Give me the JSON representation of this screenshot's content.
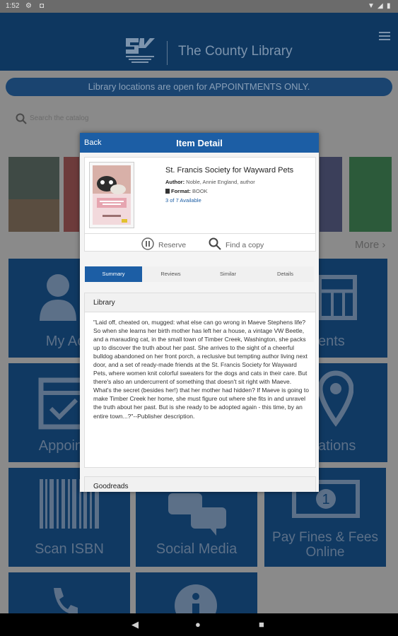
{
  "status_bar": {
    "time": "1:52"
  },
  "header": {
    "library_name": "The County Library"
  },
  "banner": {
    "text": "Library locations are open for APPOINTMENTS ONLY."
  },
  "search": {
    "placeholder": "Search the catalog"
  },
  "carousel": {
    "more_label": "More"
  },
  "tiles": {
    "my_account": "My Acc",
    "events": "ents",
    "appointments": "Appointm",
    "locations": "ations",
    "scan_isbn": "Scan ISBN",
    "social_media": "Social Media",
    "pay_fines": "Pay Fines & Fees Online"
  },
  "modal": {
    "back_label": "Back",
    "title": "Item Detail",
    "book": {
      "title": "St. Francis Society for Wayward Pets",
      "author_label": "Author:",
      "author": "Noble, Annie England, author",
      "format_label": "Format:",
      "format": "BOOK",
      "availability": "3 of 7 Available"
    },
    "actions": {
      "reserve": "Reserve",
      "find_copy": "Find a copy"
    },
    "tabs": [
      "Summary",
      "Reviews",
      "Similar",
      "Details"
    ],
    "active_tab": "Summary",
    "summary_section": "Library",
    "summary_text": "\"Laid off, cheated on, mugged: what else can go wrong in Maeve Stephens life? So when she learns her birth mother has left her a house, a vintage VW Beetle, and a marauding cat, in the small town of Timber Creek, Washington, she packs up to discover the truth about her past. She arrives to the sight of a cheerful bulldog abandoned on her front porch, a reclusive but tempting author living next door, and a set of ready-made friends at the St. Francis Society for Wayward Pets, where women knit colorful sweaters for the dogs and cats in their care. But there's also an undercurrent of something that doesn't sit right with Maeve. What's the secret (besides her!) that her mother had hidden? If Maeve is going to make Timber Creek her home, she must figure out where she fits in and unravel the truth about her past. But is she ready to be adopted again - this time, by an entire town...?\"--Publisher description.",
    "goodreads_section": "Goodreads"
  },
  "colors": {
    "primary": "#1c5ea5",
    "header_dim": "#0e3760",
    "tile_dim": "#103962"
  }
}
